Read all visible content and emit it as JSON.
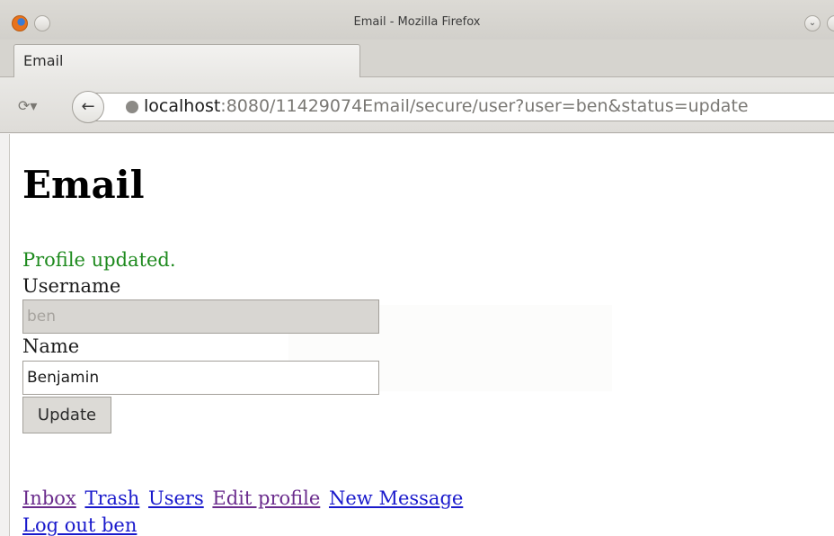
{
  "window": {
    "title": "Email - Mozilla Firefox"
  },
  "tab": {
    "label": "Email"
  },
  "urlbar": {
    "host": "localhost",
    "path": ":8080/11429074Email/secure/user?user=ben&status=update"
  },
  "page": {
    "heading": "Email",
    "status_message": "Profile updated.",
    "username_label": "Username",
    "username_value": "ben",
    "name_label": "Name",
    "name_value": "Benjamin",
    "update_button": "Update"
  },
  "nav_links": {
    "inbox": "Inbox",
    "trash": "Trash",
    "users": "Users",
    "edit_profile": "Edit profile",
    "new_message": "New Message",
    "logout": "Log out ben"
  },
  "icons": {
    "app": "firefox-icon",
    "back": "back-arrow-icon",
    "history": "history-icon",
    "site": "globe-icon"
  },
  "colors": {
    "status_green": "#1e8a1e",
    "link_visited": "#6a2b8c",
    "link_unvisited": "#1a1acc"
  }
}
